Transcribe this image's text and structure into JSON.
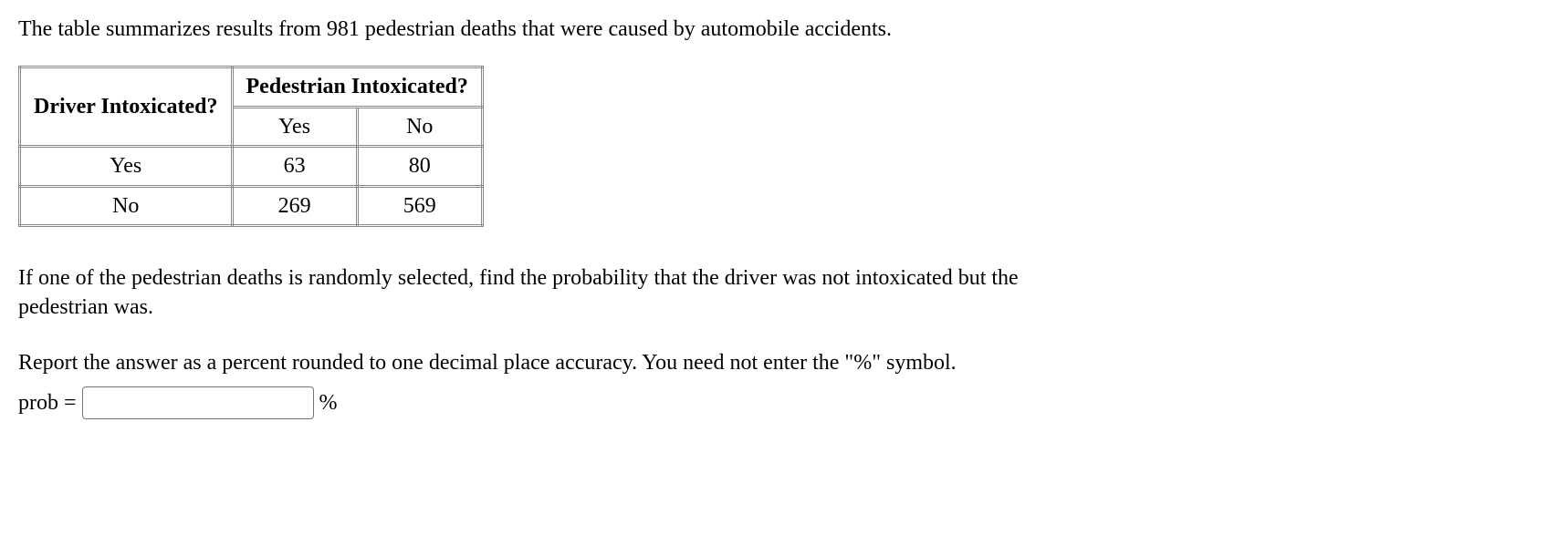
{
  "intro": "The table summarizes results from 981 pedestrian deaths that were caused by automobile accidents.",
  "table": {
    "row_header": "Driver Intoxicated?",
    "col_header": "Pedestrian Intoxicated?",
    "col_labels": [
      "Yes",
      "No"
    ],
    "rows": [
      {
        "label": "Yes",
        "cells": [
          "63",
          "80"
        ]
      },
      {
        "label": "No",
        "cells": [
          "269",
          "569"
        ]
      }
    ]
  },
  "question": "If one of the pedestrian deaths is randomly selected, find the probability that the driver was not intoxicated but the pedestrian was.",
  "instruction": "Report the answer as a percent rounded to one decimal place accuracy. You need not enter the \"%\" symbol.",
  "answer": {
    "label": "prob =",
    "unit": "%",
    "value": ""
  }
}
